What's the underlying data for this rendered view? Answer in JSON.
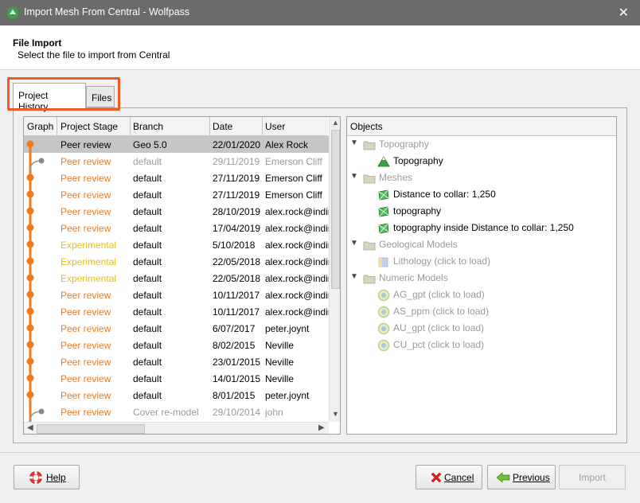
{
  "window": {
    "title": "Import Mesh From Central - Wolfpass",
    "close_glyph": "✕"
  },
  "header": {
    "title": "File Import",
    "subtitle": "Select the file to import from Central"
  },
  "tabs": [
    {
      "label": "Project History"
    },
    {
      "label": "Files"
    }
  ],
  "history": {
    "columns": [
      "Graph",
      "Project Stage",
      "Branch",
      "Date",
      "User"
    ],
    "rows": [
      {
        "stage": "Peer review",
        "branch": "Geo 5.0",
        "date": "22/01/2020",
        "user": "Alex Rock",
        "stage_type": "selected"
      },
      {
        "stage": "Peer review",
        "branch": "default",
        "date": "29/11/2019",
        "user": "Emerson Cliff",
        "stage_type": "peer-dim"
      },
      {
        "stage": "Peer review",
        "branch": "default",
        "date": "27/11/2019",
        "user": "Emerson Cliff",
        "stage_type": "peer"
      },
      {
        "stage": "Peer review",
        "branch": "default",
        "date": "27/11/2019",
        "user": "Emerson Cliff",
        "stage_type": "peer"
      },
      {
        "stage": "Peer review",
        "branch": "default",
        "date": "28/10/2019",
        "user": "alex.rock@indir",
        "stage_type": "peer"
      },
      {
        "stage": "Peer review",
        "branch": "default",
        "date": "17/04/2019",
        "user": "alex.rock@indir",
        "stage_type": "peer"
      },
      {
        "stage": "Experimental",
        "branch": "default",
        "date": "5/10/2018",
        "user": "alex.rock@indir",
        "stage_type": "exp"
      },
      {
        "stage": "Experimental",
        "branch": "default",
        "date": "22/05/2018",
        "user": "alex.rock@indir",
        "stage_type": "exp"
      },
      {
        "stage": "Experimental",
        "branch": "default",
        "date": "22/05/2018",
        "user": "alex.rock@indir",
        "stage_type": "exp"
      },
      {
        "stage": "Peer review",
        "branch": "default",
        "date": "10/11/2017",
        "user": "alex.rock@indir",
        "stage_type": "peer"
      },
      {
        "stage": "Peer review",
        "branch": "default",
        "date": "10/11/2017",
        "user": "alex.rock@indir",
        "stage_type": "peer"
      },
      {
        "stage": "Peer review",
        "branch": "default",
        "date": "6/07/2017",
        "user": "peter.joynt",
        "stage_type": "peer"
      },
      {
        "stage": "Peer review",
        "branch": "default",
        "date": "8/02/2015",
        "user": "Neville",
        "stage_type": "peer"
      },
      {
        "stage": "Peer review",
        "branch": "default",
        "date": "23/01/2015",
        "user": "Neville",
        "stage_type": "peer"
      },
      {
        "stage": "Peer review",
        "branch": "default",
        "date": "14/01/2015",
        "user": "Neville",
        "stage_type": "peer"
      },
      {
        "stage": "Peer review",
        "branch": "default",
        "date": "8/01/2015",
        "user": "peter.joynt",
        "stage_type": "peer"
      },
      {
        "stage": "Peer review",
        "branch": "Cover re-model",
        "date": "29/10/2014",
        "user": "john",
        "stage_type": "peer-dim"
      }
    ]
  },
  "objects": {
    "header": "Objects",
    "groups": [
      {
        "label": "Topography",
        "items": [
          {
            "label": "Topography",
            "icon": "topography-icon",
            "enabled": true
          }
        ]
      },
      {
        "label": "Meshes",
        "items": [
          {
            "label": "Distance to collar: 1,250",
            "icon": "mesh-icon",
            "enabled": true
          },
          {
            "label": "topography",
            "icon": "mesh-icon",
            "enabled": true
          },
          {
            "label": "topography inside Distance to collar: 1,250",
            "icon": "mesh-icon",
            "enabled": true
          }
        ]
      },
      {
        "label": "Geological Models",
        "items": [
          {
            "label": "Lithology (click to load)",
            "icon": "geomodel-icon",
            "enabled": false
          }
        ]
      },
      {
        "label": "Numeric Models",
        "items": [
          {
            "label": "AG_gpt (click to load)",
            "icon": "numeric-model-icon",
            "enabled": false
          },
          {
            "label": "AS_ppm (click to load)",
            "icon": "numeric-model-icon",
            "enabled": false
          },
          {
            "label": "AU_gpt (click to load)",
            "icon": "numeric-model-icon",
            "enabled": false
          },
          {
            "label": "CU_pct (click to load)",
            "icon": "numeric-model-icon",
            "enabled": false
          }
        ]
      }
    ]
  },
  "buttons": {
    "help": "Help",
    "cancel": "Cancel",
    "previous": "Previous",
    "import": "Import"
  },
  "colors": {
    "peer": "#f07a1e",
    "experimental": "#e2c11e",
    "graph": "#f07a1e",
    "highlight": "#f05a22"
  }
}
